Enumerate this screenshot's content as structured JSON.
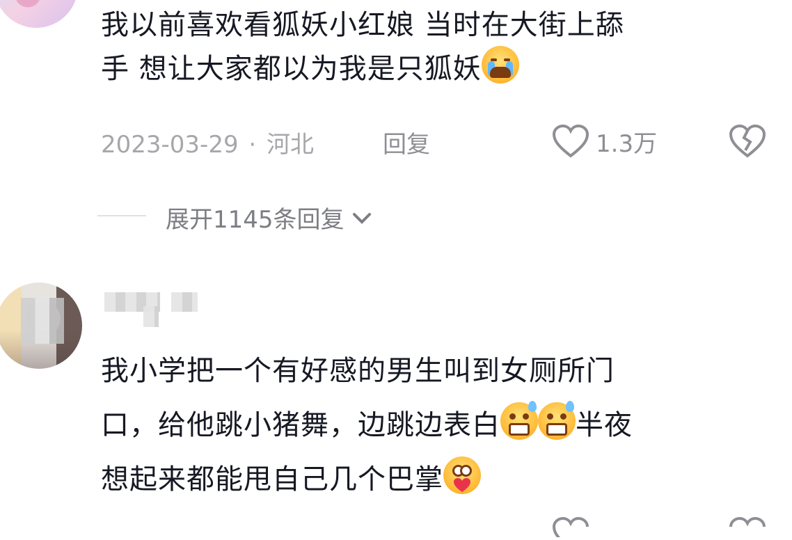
{
  "comments": [
    {
      "avatar_icon": "avatar-anime-icon",
      "text_part1": "我以前喜欢看狐妖小红娘 当时在大街上舔",
      "text_part2": "手 想让大家都以为我是只狐妖",
      "emoji": "loudly-crying-face",
      "date": "2023-03-29",
      "separator": "·",
      "location": "河北",
      "reply_label": "回复",
      "like_count": "1.3万",
      "expand_label": "展开1145条回复"
    },
    {
      "avatar_icon": "avatar-blurred-icon",
      "line1": "我小学把一个有好感的男生叫到女厕所门",
      "line2_a": "口，给他跳小猪舞，边跳边表白",
      "line2_b": "半夜",
      "line3": "想起来都能甩自己几个巴掌",
      "emojis": [
        "grimacing-sweat-face",
        "grimacing-sweat-face",
        "face-holding-heart"
      ]
    }
  ],
  "colors": {
    "text": "#161823",
    "meta": "#a6a7ab",
    "expand": "#7d7e83"
  }
}
